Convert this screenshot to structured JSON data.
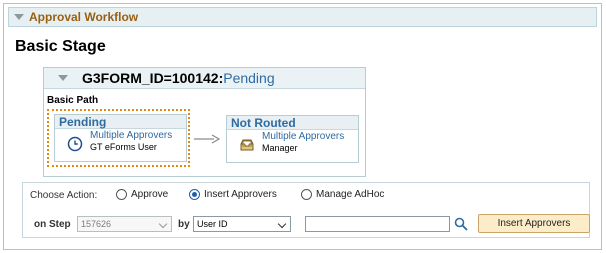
{
  "section": {
    "title": "Approval Workflow"
  },
  "stage": {
    "title": "Basic Stage"
  },
  "path": {
    "form_id": "G3FORM_ID=100142:",
    "status": "Pending",
    "label": "Basic Path",
    "steps": [
      {
        "status": "Pending",
        "link": "Multiple Approvers",
        "sub": "GT eForms User",
        "icon": "clock-icon"
      },
      {
        "status": "Not Routed",
        "link": "Multiple Approvers",
        "sub": "Manager",
        "icon": "inbox-icon"
      }
    ]
  },
  "action": {
    "choose_label": "Choose Action:",
    "options": [
      "Approve",
      "Insert Approvers",
      "Manage AdHoc"
    ],
    "selected": "Insert Approvers",
    "on_step_label": "on Step",
    "step_value": "157626",
    "by_label": "by",
    "by_value": "User ID",
    "search_value": "",
    "button_label": "Insert Approvers"
  }
}
